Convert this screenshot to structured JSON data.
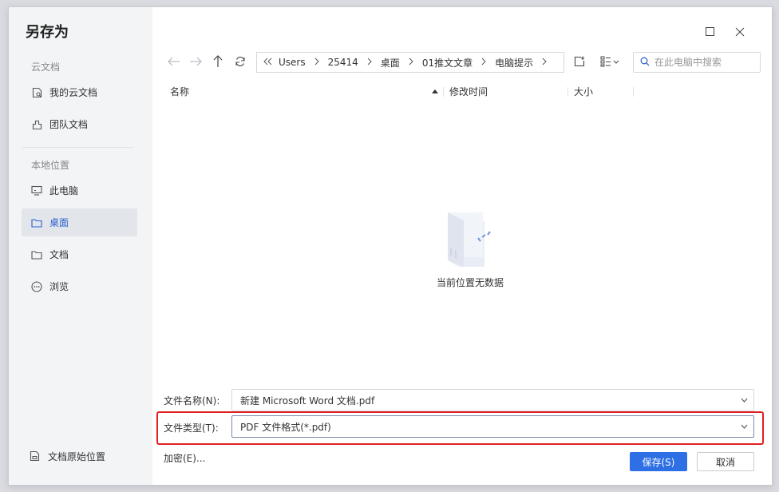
{
  "dialog": {
    "title": "另存为"
  },
  "sidebar": {
    "cloud_section": "云文档",
    "cloud_items": [
      {
        "label": "我的云文档",
        "icon": "cloud-doc-icon"
      },
      {
        "label": "团队文档",
        "icon": "team-doc-icon"
      }
    ],
    "local_section": "本地位置",
    "local_items": [
      {
        "label": "此电脑",
        "icon": "monitor-icon"
      },
      {
        "label": "桌面",
        "icon": "folder-icon",
        "active": true
      },
      {
        "label": "文档",
        "icon": "folder-icon"
      },
      {
        "label": "浏览",
        "icon": "more-icon"
      }
    ],
    "original_location": "文档原始位置"
  },
  "breadcrumb": {
    "items": [
      "Users",
      "25414",
      "桌面",
      "01推文文章",
      "电脑提示"
    ]
  },
  "search": {
    "placeholder": "在此电脑中搜索"
  },
  "columns": {
    "name": "名称",
    "modified": "修改时间",
    "size": "大小"
  },
  "empty_state": {
    "message": "当前位置无数据"
  },
  "filename": {
    "label": "文件名称(N):",
    "value": "新建 Microsoft Word 文档.pdf"
  },
  "filetype": {
    "label": "文件类型(T):",
    "value": "PDF 文件格式(*.pdf)"
  },
  "footer": {
    "encrypt": "加密(E)...",
    "save": "保存(S)",
    "cancel": "取消"
  },
  "colors": {
    "accent": "#2e6fe5",
    "active_item_bg": "#e2e5ea",
    "highlight": "#e02020"
  }
}
